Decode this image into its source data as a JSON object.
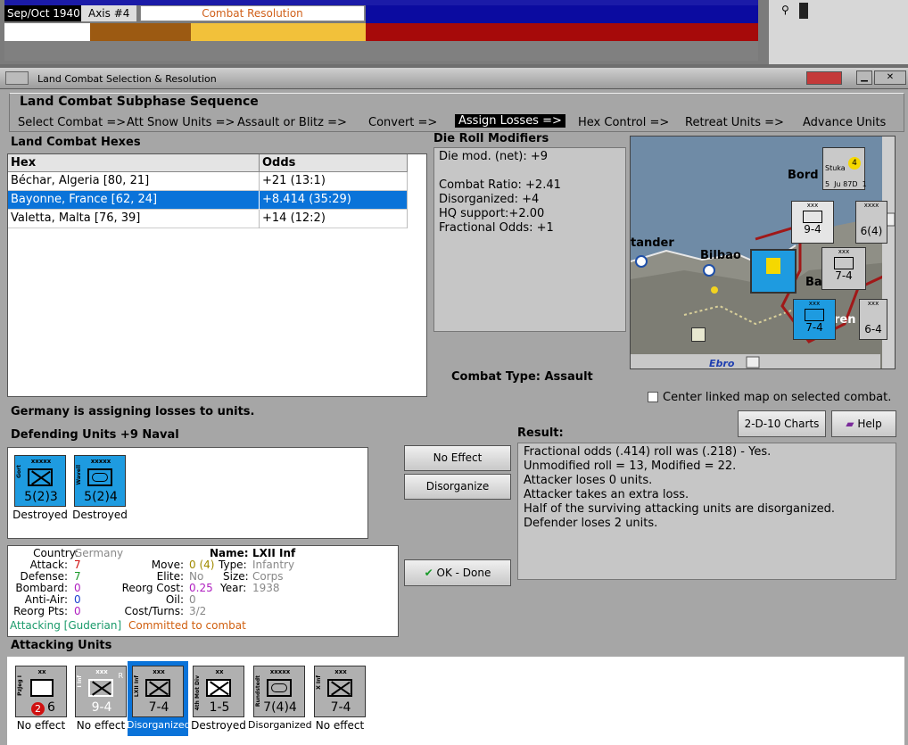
{
  "top": {
    "date": "Sep/Oct 1940",
    "axis": "Axis #4",
    "phase": "Combat Resolution"
  },
  "colors": {
    "accent_blue": "#0a73d9",
    "counter_blue": "#1e9be0",
    "counter_grey": "#b0b0b0",
    "attack_red": "#d01010",
    "phase_orange": "#d0601a"
  },
  "dialog": {
    "title": "Land Combat Selection & Resolution",
    "sequence_title": "Land Combat Subphase Sequence",
    "sequence": [
      "Select Combat =>",
      "Att Snow Units =>",
      "Assault or Blitz =>",
      "Convert =>",
      "Assign Losses =>",
      "Hex Control =>",
      "Retreat Units =>",
      "Advance Units"
    ],
    "active_step": "Assign Losses =>"
  },
  "hexes": {
    "title": "Land Combat Hexes",
    "columns": [
      "Hex",
      "Odds"
    ],
    "rows": [
      {
        "hex": "Béchar, Algeria [80, 21]",
        "odds": "+21 (13:1)"
      },
      {
        "hex": "Bayonne, France [62, 24]",
        "odds": "+8.414 (35:29)"
      },
      {
        "hex": "Valetta, Malta [76, 39]",
        "odds": "+14 (12:2)"
      }
    ],
    "selected_index": 1
  },
  "die_roll": {
    "title": "Die Roll Modifiers",
    "lines": [
      "Die mod. (net): +9",
      "",
      "Combat Ratio: +2.41",
      "Disorganized: +4",
      "HQ support:+2.00",
      "Fractional Odds: +1"
    ]
  },
  "map": {
    "labels": [
      "tander",
      "Bilbao",
      "Bord",
      "Ebro",
      "Ba",
      "ren"
    ],
    "counters": [
      {
        "icon": "infantry-icon",
        "size": "xxx",
        "value": "9-4"
      },
      {
        "icon": "infantry-icon",
        "size": "xxx",
        "value": "7-4"
      },
      {
        "icon": "infantry-icon",
        "size": "xxx",
        "value": "7-4"
      },
      {
        "icon": "infantry-icon",
        "size": "xxxx",
        "value": "6(4)"
      },
      {
        "icon": "infantry-icon",
        "size": "xxx",
        "value": "6-4"
      },
      {
        "icon": "aircraft-icon",
        "size": "",
        "value": "5  Ju 87D  1",
        "name": "Stuka",
        "badge": "4"
      }
    ]
  },
  "combat_type": {
    "label": "Combat Type:",
    "value": "Assault"
  },
  "center_linked": "Center linked map on selected combat.",
  "buttons": {
    "charts": "2-D-10 Charts",
    "help": "Help",
    "no_effect": "No Effect",
    "disorganize": "Disorganize",
    "ok_done": "OK - Done"
  },
  "assigning_msg": "Germany is assigning losses to units.",
  "defending": {
    "title": "Defending Units +9 Naval",
    "units": [
      {
        "name": "Gort",
        "size": "xxxxx",
        "value": "5(2)3",
        "icon": "infantry-icon",
        "status": "Destroyed"
      },
      {
        "name": "Wavell",
        "size": "xxxxx",
        "value": "5(2)4",
        "icon": "armor-icon",
        "status": "Destroyed"
      }
    ]
  },
  "unit_info": {
    "country_label": "Country:",
    "country": "Germany",
    "attack_label": "Attack:",
    "attack": "7",
    "defense_label": "Defense:",
    "defense": "7",
    "bombard_label": "Bombard:",
    "bombard": "0",
    "antiair_label": "Anti-Air:",
    "antiair": "0",
    "reorg_pts_label": "Reorg Pts:",
    "reorg_pts": "0",
    "name_label": "Name:",
    "name": "LXII Inf",
    "move_label": "Move:",
    "move": "0 (4)",
    "type_label": "Type:",
    "type": "Infantry",
    "elite_label": "Elite:",
    "elite": "No",
    "size_label": "Size:",
    "size": "Corps",
    "reorg_cost_label": "Reorg Cost:",
    "reorg_cost": "0.25",
    "year_label": "Year:",
    "year": "1938",
    "oil_label": "Oil:",
    "oil": "0",
    "cost_turns_label": "Cost/Turns:",
    "cost_turns": "3/2",
    "status_attacking": "Attacking [Guderian]",
    "status_committed": "Committed to combat"
  },
  "result": {
    "title": "Result:",
    "lines": [
      "Fractional odds (.414) roll was (.218)  - Yes.",
      "Unmodified roll = 13, Modified = 22.",
      "Attacker loses 0 units.",
      "Attacker takes an extra loss.",
      "Half of the surviving attacking units are disorganized.",
      "Defender loses 2 units."
    ]
  },
  "attacking": {
    "title": "Attacking Units",
    "units": [
      {
        "name": "PzJeg I",
        "size": "xx",
        "value": "6",
        "badge": "2",
        "icon": "recon-icon",
        "status": "No effect"
      },
      {
        "name": "I Inf",
        "size": "xxx",
        "value": "9-4",
        "icon": "infantry-icon",
        "status": "No effect",
        "flag": "R"
      },
      {
        "name": "LXII Inf",
        "size": "xxx",
        "value": "7-4",
        "icon": "infantry-icon",
        "status": "Disorganized",
        "selected": true
      },
      {
        "name": "4th Mot Div",
        "size": "xx",
        "value": "1-5",
        "icon": "motorized-icon",
        "status": "Destroyed"
      },
      {
        "name": "Rundstedt",
        "size": "xxxxx",
        "value": "7(4)4",
        "icon": "armor-icon",
        "status": "Disorganized"
      },
      {
        "name": "X Inf",
        "size": "xxx",
        "value": "7-4",
        "icon": "infantry-icon",
        "status": "No effect"
      }
    ]
  }
}
